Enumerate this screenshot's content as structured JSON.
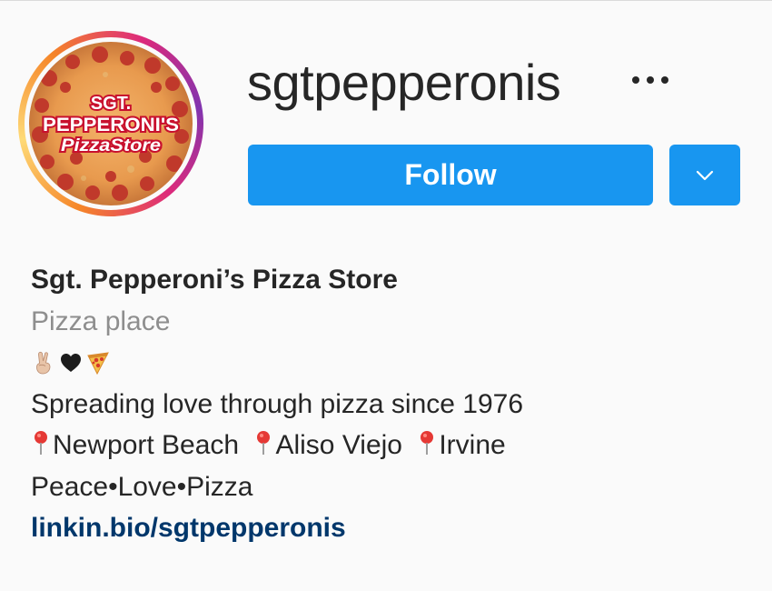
{
  "profile": {
    "username": "sgtpepperonis",
    "avatar_alt": "SGT. PEPPERONI'S PIZZA STORE logo on pepperoni pizza",
    "avatar_logo_lines": [
      "SGT.",
      "PEPPERONI'S",
      "PizzaStore"
    ],
    "follow_label": "Follow",
    "more_icon": "ellipsis-icon",
    "dropdown_icon": "chevron-down-icon"
  },
  "bio": {
    "full_name": "Sgt. Pepperoni’s Pizza Store",
    "category": "Pizza place",
    "emojis": [
      "victory-hand-icon",
      "black-heart-icon",
      "pizza-slice-icon"
    ],
    "tagline": "Spreading love through pizza since 1976",
    "locations": [
      "Newport Beach",
      "Aliso Viejo",
      "Irvine"
    ],
    "motto": "Peace•Love•Pizza",
    "link": "linkin.bio/sgtpepperonis"
  },
  "colors": {
    "follow_blue": "#1896f0",
    "link_blue": "#00376b",
    "category_gray": "#8e8e8e",
    "text": "#262626",
    "background": "#fafafa",
    "logo_red": "#c8102e"
  }
}
